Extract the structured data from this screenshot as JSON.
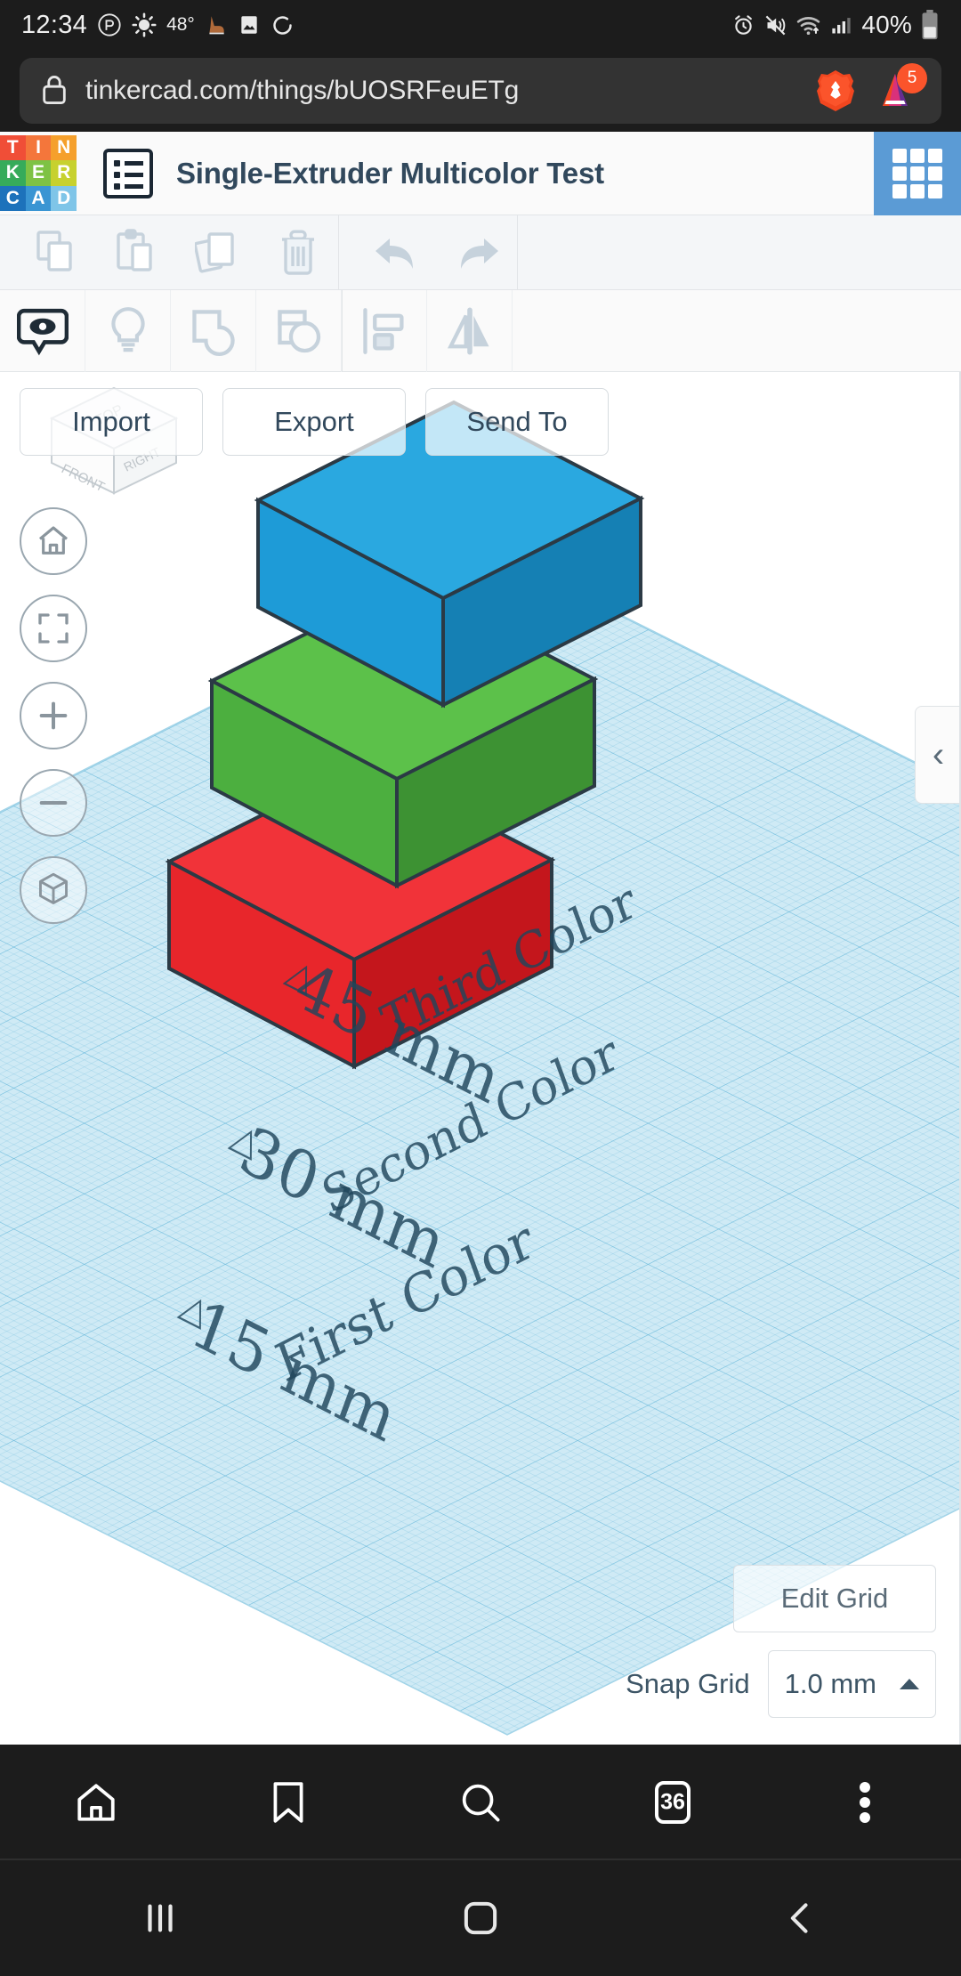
{
  "status_bar": {
    "time": "12:34",
    "temperature": "48°",
    "battery_percent": "40%",
    "left_icons": [
      "data-saver-icon",
      "brightness-icon",
      "weather-icon",
      "boot-icon",
      "image-icon",
      "sync-icon"
    ],
    "right_icons": [
      "alarm-icon",
      "mute-vibrate-icon",
      "wifi-icon",
      "cellular-signal-icon",
      "battery-icon"
    ]
  },
  "browser": {
    "url": "tinkercad.com/things/bUOSRFeuETg",
    "lock_icon": "lock-icon",
    "brave_icon": "brave-lion-icon",
    "rewards_icon": "brave-rewards-triangle-icon",
    "rewards_badge": "5",
    "bottom_nav": [
      {
        "name": "home-icon",
        "label": "Home"
      },
      {
        "name": "bookmark-icon",
        "label": "Bookmarks"
      },
      {
        "name": "search-icon",
        "label": "Search"
      },
      {
        "name": "tabs-icon",
        "label": "Tabs"
      },
      {
        "name": "more-menu-icon",
        "label": "More"
      }
    ],
    "tab_count": "36"
  },
  "system_nav": {
    "recents_icon": "recents-icon",
    "home_icon": "home-square-icon",
    "back_icon": "back-chevron-icon"
  },
  "tinkercad": {
    "logo_tiles": [
      {
        "letter": "T",
        "color": "#f04e37"
      },
      {
        "letter": "I",
        "color": "#f4763b"
      },
      {
        "letter": "N",
        "color": "#f5a02c"
      },
      {
        "letter": "K",
        "color": "#36ab5a"
      },
      {
        "letter": "E",
        "color": "#7ec244"
      },
      {
        "letter": "R",
        "color": "#c7d12e"
      },
      {
        "letter": "C",
        "color": "#1d72bb"
      },
      {
        "letter": "A",
        "color": "#3a95d3"
      },
      {
        "letter": "D",
        "color": "#7fc5e8"
      }
    ],
    "menu_icon": "list-menu-icon",
    "project_title": "Single-Extruder Multicolor Test",
    "apps_grid_icon": "apps-grid-icon",
    "accent_blue": "#5b9bd5",
    "toolbar_primary": [
      {
        "name": "copy-icon",
        "label": "Copy",
        "enabled": false
      },
      {
        "name": "paste-icon",
        "label": "Paste",
        "enabled": false
      },
      {
        "name": "duplicate-icon",
        "label": "Duplicate",
        "enabled": false
      },
      {
        "name": "delete-trash-icon",
        "label": "Delete",
        "enabled": false
      },
      {
        "name": "undo-arrow-icon",
        "label": "Undo",
        "enabled": false
      },
      {
        "name": "redo-arrow-icon",
        "label": "Redo",
        "enabled": false
      }
    ],
    "toolbar_secondary": [
      {
        "name": "visibility-eye-icon",
        "label": "Show/Hide",
        "active": true
      },
      {
        "name": "lightbulb-icon",
        "label": "Hide Others",
        "active": false
      },
      {
        "name": "group-shapes-icon",
        "label": "Group",
        "active": false
      },
      {
        "name": "ungroup-shapes-icon",
        "label": "Ungroup",
        "active": false
      },
      {
        "name": "align-icon",
        "label": "Align",
        "active": false
      },
      {
        "name": "mirror-flip-icon",
        "label": "Mirror",
        "active": false
      }
    ],
    "file_buttons": [
      {
        "name": "import-button",
        "label": "Import"
      },
      {
        "name": "export-button",
        "label": "Export"
      },
      {
        "name": "send-to-button",
        "label": "Send To"
      }
    ],
    "view_nav": [
      {
        "name": "home-view-icon",
        "label": "Home View"
      },
      {
        "name": "fit-to-view-icon",
        "label": "Fit all in view"
      },
      {
        "name": "zoom-in-icon",
        "label": "Zoom in"
      },
      {
        "name": "zoom-out-icon",
        "label": "Zoom out"
      },
      {
        "name": "ortho-perspective-icon",
        "label": "Switch to orthographic view"
      }
    ],
    "view_cube": {
      "name": "view-cube",
      "face_top": "TOP",
      "face_front": "FRONT",
      "face_right": "RIGHT"
    },
    "panel_collapse_icon": "chevron-left-icon",
    "grid_controls": {
      "edit_grid_label": "Edit Grid",
      "snap_grid_label": "Snap Grid",
      "snap_grid_value": "1.0 mm",
      "snap_caret_icon": "caret-up-icon"
    },
    "workplane": {
      "fill_color": "#cfeaf5",
      "grid_line_color": "#56b0d6"
    },
    "objects": [
      {
        "name": "block-third-color",
        "title": "Third Color",
        "dimension_label": "45 mm",
        "color": "#1e9bd7",
        "color_top": "#2aa8e0",
        "color_side": "#1580b4",
        "handle_icon": "height-handle-arrow"
      },
      {
        "name": "block-second-color",
        "title": "Second Color",
        "dimension_label": "30 mm",
        "color": "#4caf3f",
        "color_top": "#5cc14a",
        "color_side": "#3d9233",
        "handle_icon": "height-handle-arrow"
      },
      {
        "name": "block-first-color",
        "title": "First Color",
        "dimension_label": "15 mm",
        "color": "#e8262b",
        "color_top": "#f13339",
        "color_side": "#c4161c",
        "handle_icon": "height-handle-arrow"
      }
    ]
  }
}
